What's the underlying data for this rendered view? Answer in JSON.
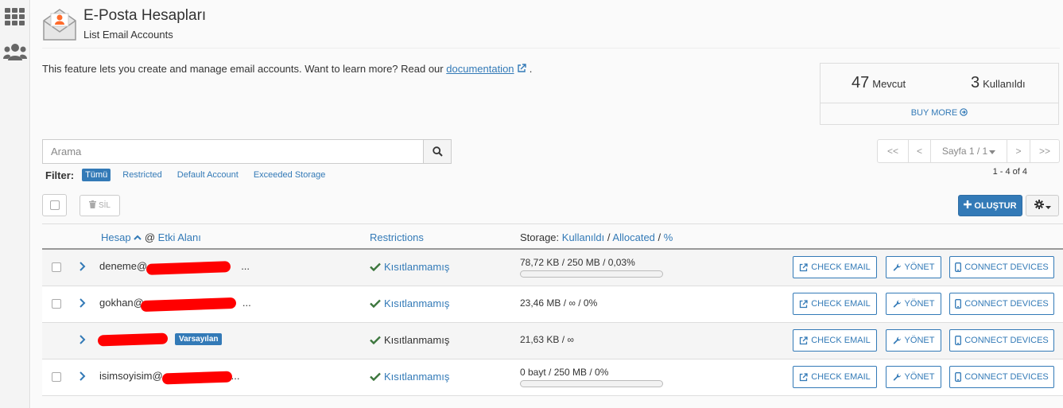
{
  "header": {
    "title": "E-Posta Hesapları",
    "subtitle": "List Email Accounts"
  },
  "intro": {
    "text": "This feature lets you create and manage email accounts. Want to learn more? Read our",
    "link": "documentation",
    "tail": "."
  },
  "stats": {
    "available_count": "47",
    "available_label": "Mevcut",
    "used_count": "3",
    "used_label": "Kullanıldı",
    "buy_more": "BUY MORE"
  },
  "search": {
    "placeholder": "Arama",
    "value": ""
  },
  "filter": {
    "label": "Filter:",
    "options": [
      "Tümü",
      "Restricted",
      "Default Account",
      "Exceeded Storage"
    ],
    "active": "Tümü"
  },
  "pagination": {
    "first": "<<",
    "prev": "<",
    "page_label": "Sayfa 1 / 1",
    "next": ">",
    "last": ">>",
    "result_count": "1 - 4 of 4"
  },
  "toolbar": {
    "delete_label": "SİL",
    "create_label": "OLUŞTUR"
  },
  "table": {
    "col_account": "Hesap",
    "col_at": "@",
    "col_domain": "Etki Alanı",
    "col_restrictions": "Restrictions",
    "col_storage": "Storage:",
    "col_used": "Kullanıldı",
    "col_sep1": "/",
    "col_allocated": "Allocated",
    "col_sep2": "/",
    "col_percent": "%",
    "rows": [
      {
        "email": "deneme@",
        "email_tail": "...",
        "restriction": "Kısıtlanmamış",
        "storage": "78,72 KB / 250 MB / 0,03%",
        "usage_percent": 0.03
      },
      {
        "email": "gokhan@",
        "email_tail": "...",
        "restriction": "Kısıtlanmamış",
        "storage": "23,46 MB / ∞ / 0%"
      },
      {
        "badge": "Varsayılan",
        "restriction": "Kısıtlanmamış",
        "storage": "21,63 KB / ∞"
      },
      {
        "email": "isimsoyisim@",
        "email_tail": "...",
        "restriction": "Kısıtlanmamış",
        "storage": "0 bayt / 250 MB / 0%",
        "usage_percent": 0
      }
    ],
    "actions": {
      "check_email": "CHECK EMAIL",
      "manage": "YÖNET",
      "connect": "CONNECT DEVICES"
    }
  },
  "colors": {
    "accent": "#337ab7",
    "success": "#3c763d",
    "redaction": "#ff0000"
  }
}
